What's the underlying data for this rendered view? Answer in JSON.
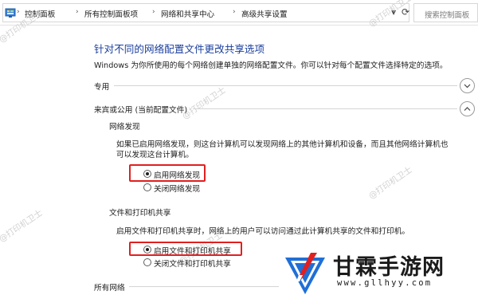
{
  "address_bar": {
    "breadcrumbs": [
      "控制面板",
      "所有控制面板项",
      "网络和共享中心",
      "高级共享设置"
    ],
    "search_placeholder": "搜索控制面板"
  },
  "page": {
    "title": "针对不同的网络配置文件更改共享选项",
    "description": "Windows 为你所使用的每个网络创建单独的网络配置文件。你可以针对每个配置文件选择特定的选项。"
  },
  "sections": {
    "private": {
      "label": "专用",
      "state": "collapsed"
    },
    "guest_public": {
      "label": "来宾或公用 (当前配置文件)",
      "state": "expanded"
    },
    "all_networks": {
      "label": "所有网络"
    }
  },
  "network_discovery": {
    "heading": "网络发现",
    "text_line1": "如果已启用网络发现，则这台计算机可以发现网络上的其他计算机和设备，而且其他网络计算机也",
    "text_line2": "可以发现这台计算机。",
    "option_on": "启用网络发现",
    "option_off": "关闭网络发现",
    "selected": "on"
  },
  "file_printer_sharing": {
    "heading": "文件和打印机共享",
    "text": "启用文件和打印机共享时，网络上的用户可以访问通过此计算机共享的文件和打印机。",
    "option_on": "启用文件和打印机共享",
    "option_off": "关闭文件和打印机共享",
    "selected": "on"
  },
  "watermark": {
    "text": "@打印机卫士",
    "brand_name": "甘霖手游网",
    "brand_url": "www.gllhyy.com"
  },
  "colors": {
    "title": "#1a3e9c",
    "highlight": "#e02020",
    "logo_blue": "#1f6fd6"
  }
}
